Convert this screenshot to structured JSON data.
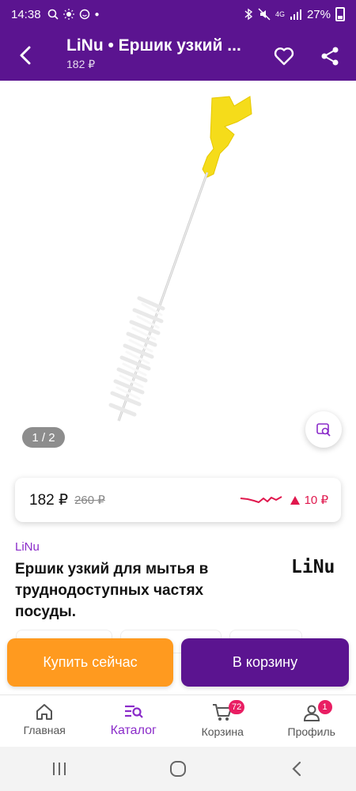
{
  "status_bar": {
    "time": "14:38",
    "battery": "27%",
    "network": "4G"
  },
  "header": {
    "title": "LiNu • Ершик узкий ...",
    "subtitle": "182 ₽"
  },
  "gallery": {
    "pager": "1 / 2"
  },
  "price": {
    "current": "182 ₽",
    "old": "260 ₽",
    "delta": "10 ₽"
  },
  "product": {
    "brand": "LiNu",
    "name": "Ершик узкий для мытья в труднодоступных частях посуды.",
    "brand_logo": "LiNu"
  },
  "actions": {
    "buy_now": "Купить сейчас",
    "add_to_cart": "В корзину"
  },
  "bottom_nav": {
    "items": [
      {
        "label": "Главная"
      },
      {
        "label": "Каталог"
      },
      {
        "label": "Корзина",
        "badge": "72"
      },
      {
        "label": "Профиль",
        "badge": "1"
      }
    ]
  },
  "colors": {
    "brand": "#5b1490",
    "accent": "#8a2bc9",
    "buy": "#ff9a1f",
    "badge": "#e91e63"
  }
}
